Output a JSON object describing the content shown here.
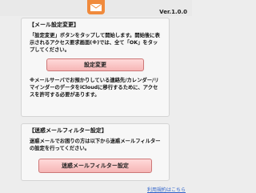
{
  "header": {
    "version": "Ver.1.0.0"
  },
  "mail_settings": {
    "title": "【メール設定変更】",
    "para1": "「設定変更」ボタンをタップして開始します。開始後に表示されるアクセス要求画面(※)では、全て「OK」をタップしてください。",
    "button": "設定変更",
    "para2": "※メールサーバでお預かりしている連絡先/カレンダー/リマインダーのデータをiCloudに移行するために、アクセスを許可する必要があります。"
  },
  "spam_filter": {
    "title": "【迷惑メールフィルター設定】",
    "para": "迷惑メールでお困りの方は以下から迷惑メールフィルターの設定を行ってください。",
    "button": "迷惑メールフィルター設定"
  },
  "footer": {
    "link": "利用規約はこちら"
  },
  "colors": {
    "button_fill": "#f6b6b6",
    "icon_orange": "#f08a3c"
  }
}
